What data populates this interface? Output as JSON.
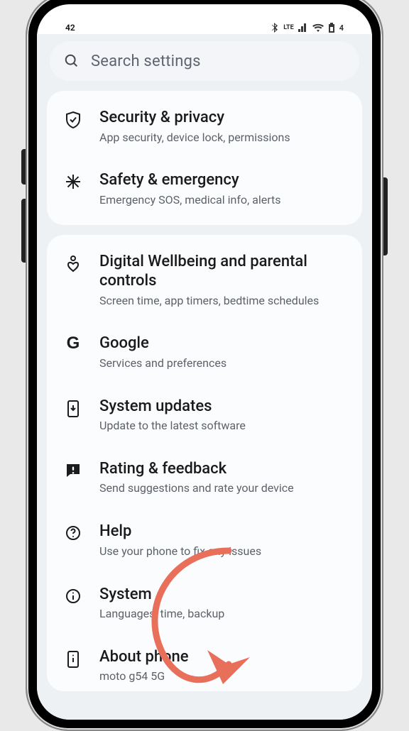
{
  "status": {
    "time": "42",
    "lte": "LTE",
    "right_extra": "4"
  },
  "search": {
    "placeholder": "Search settings"
  },
  "group1": {
    "items": [
      {
        "title": "Security & privacy",
        "sub": "App security, device lock, permissions"
      },
      {
        "title": "Safety & emergency",
        "sub": "Emergency SOS, medical info, alerts"
      }
    ]
  },
  "group2": {
    "items": [
      {
        "title": "Digital Wellbeing and parental controls",
        "sub": "Screen time, app timers, bedtime schedules"
      },
      {
        "title": "Google",
        "sub": "Services and preferences"
      },
      {
        "title": "System updates",
        "sub": "Update to the latest software"
      },
      {
        "title": "Rating & feedback",
        "sub": "Send suggestions and rate your device"
      },
      {
        "title": "Help",
        "sub": "Use your phone to fix any issues"
      },
      {
        "title": "System",
        "sub": "Languages, time, backup"
      },
      {
        "title": "About phone",
        "sub": "moto g54 5G"
      }
    ]
  },
  "annotation": {
    "color": "#e86f5a"
  }
}
